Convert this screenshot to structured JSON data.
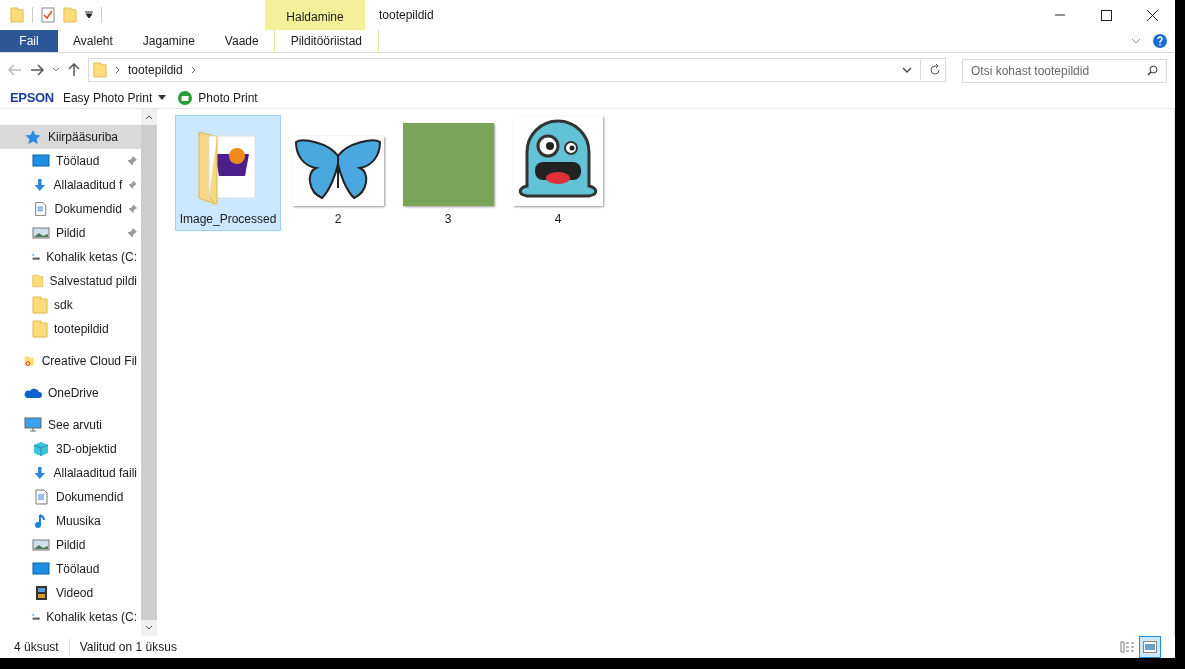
{
  "window": {
    "title": "tootepildid",
    "context_tab": "Haldamine"
  },
  "ribbon_tabs": [
    {
      "label": "Fail",
      "kind": "file",
      "selected": false
    },
    {
      "label": "Avaleht",
      "kind": "tab",
      "selected": false
    },
    {
      "label": "Jagamine",
      "kind": "tab",
      "selected": false
    },
    {
      "label": "Vaade",
      "kind": "tab",
      "selected": false
    },
    {
      "label": "Pilditööriistad",
      "kind": "context",
      "selected": false
    }
  ],
  "address": {
    "path": [
      "tootepildid"
    ],
    "search_placeholder": "Otsi kohast tootepildid"
  },
  "toolbar": {
    "brand": "EPSON",
    "items": [
      {
        "label": "Easy Photo Print",
        "kind": "dropdown"
      },
      {
        "label": "Photo Print",
        "kind": "printer"
      }
    ]
  },
  "sidebar": {
    "sections": [
      {
        "label": "Kiirpääsuriba",
        "kind": "star",
        "selected": true,
        "children": [
          {
            "label": "Töölaud",
            "kind": "desktop",
            "pinned": true,
            "selected": false
          },
          {
            "label": "Allalaaditud f",
            "kind": "download",
            "pinned": true,
            "selected": false
          },
          {
            "label": "Dokumendid",
            "kind": "document",
            "pinned": true,
            "selected": false
          },
          {
            "label": "Pildid",
            "kind": "pictures",
            "pinned": true,
            "selected": false
          },
          {
            "label": "Kohalik ketas (C:",
            "kind": "drive",
            "pinned": false,
            "selected": false
          },
          {
            "label": "Salvestatud pildi",
            "kind": "folder",
            "pinned": false,
            "selected": false
          },
          {
            "label": "sdk",
            "kind": "folder",
            "pinned": false,
            "selected": false
          },
          {
            "label": "tootepildid",
            "kind": "folder",
            "pinned": false,
            "selected": false
          }
        ]
      },
      {
        "label": "Creative Cloud Fil",
        "kind": "cloudfolder",
        "selected": false
      },
      {
        "label": "OneDrive",
        "kind": "onedrive",
        "selected": false
      },
      {
        "label": "See arvuti",
        "kind": "computer",
        "selected": false,
        "children": [
          {
            "label": "3D-objektid",
            "kind": "cube",
            "pinned": false,
            "selected": false
          },
          {
            "label": "Allalaaditud faili",
            "kind": "download",
            "pinned": false,
            "selected": false
          },
          {
            "label": "Dokumendid",
            "kind": "document",
            "pinned": false,
            "selected": false
          },
          {
            "label": "Muusika",
            "kind": "music",
            "pinned": false,
            "selected": false
          },
          {
            "label": "Pildid",
            "kind": "pictures",
            "pinned": false,
            "selected": false
          },
          {
            "label": "Töölaud",
            "kind": "desktop",
            "pinned": false,
            "selected": false
          },
          {
            "label": "Videod",
            "kind": "video",
            "pinned": false,
            "selected": false
          },
          {
            "label": "Kohalik ketas (C:",
            "kind": "drive",
            "pinned": false,
            "selected": false
          }
        ]
      }
    ]
  },
  "files": [
    {
      "name": "Image_Processed",
      "kind": "folder",
      "selected": true
    },
    {
      "name": "2",
      "kind": "butterfly",
      "selected": false
    },
    {
      "name": "3",
      "kind": "photo",
      "selected": false
    },
    {
      "name": "4",
      "kind": "monster",
      "selected": false
    }
  ],
  "status_bar": {
    "count": "4 üksust",
    "selection": "Valitud on 1 üksus",
    "views": [
      {
        "kind": "details",
        "selected": false
      },
      {
        "kind": "large",
        "selected": true
      }
    ]
  }
}
